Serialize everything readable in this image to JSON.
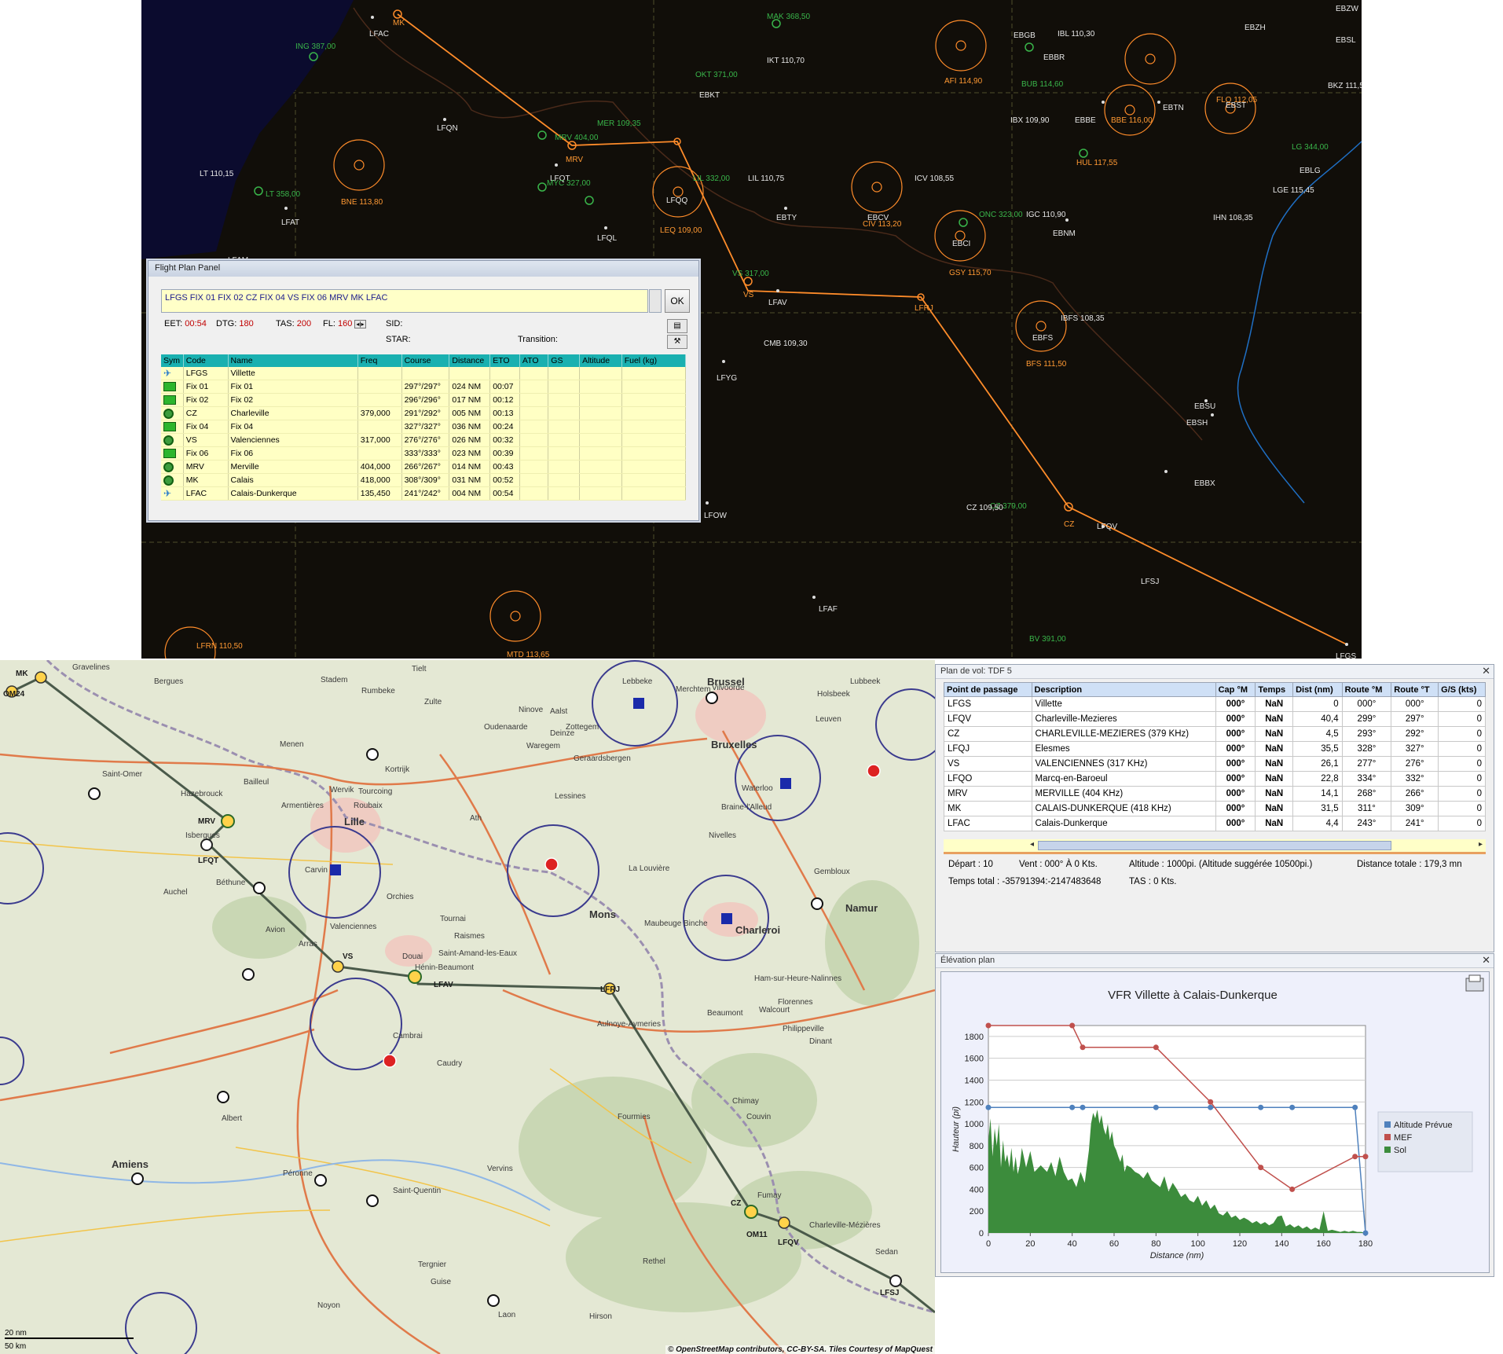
{
  "flight_plan_panel": {
    "title": "Flight Plan Panel",
    "route_string": "LFGS FIX 01 FIX 02 CZ FIX 04 VS FIX 06 MRV MK LFAC",
    "ok_label": "OK",
    "eet_label": "EET:",
    "eet_value": "00:54",
    "dtg_label": "DTG:",
    "dtg_value": "180",
    "tas_label": "TAS:",
    "tas_value": "200",
    "fl_label": "FL:",
    "fl_value": "160",
    "sid_label": "SID:",
    "star_label": "STAR:",
    "transition_label": "Transition:",
    "columns": [
      "Sym",
      "Code",
      "Name",
      "Freq",
      "Course",
      "Distance",
      "ETO",
      "ATO",
      "GS",
      "Altitude",
      "Fuel (kg)"
    ],
    "rows": [
      {
        "sym": "airport",
        "code": "LFGS",
        "name": "Villette",
        "freq": "",
        "course": "",
        "distance": "",
        "eto": ""
      },
      {
        "sym": "fix",
        "code": "Fix 01",
        "name": "Fix 01",
        "freq": "",
        "course": "297°/297°",
        "distance": "024 NM",
        "eto": "00:07"
      },
      {
        "sym": "fix",
        "code": "Fix 02",
        "name": "Fix 02",
        "freq": "",
        "course": "296°/296°",
        "distance": "017 NM",
        "eto": "00:12"
      },
      {
        "sym": "vor",
        "code": "CZ",
        "name": "Charleville",
        "freq": "379,000",
        "course": "291°/292°",
        "distance": "005 NM",
        "eto": "00:13"
      },
      {
        "sym": "fix",
        "code": "Fix 04",
        "name": "Fix 04",
        "freq": "",
        "course": "327°/327°",
        "distance": "036 NM",
        "eto": "00:24"
      },
      {
        "sym": "vor",
        "code": "VS",
        "name": "Valenciennes",
        "freq": "317,000",
        "course": "276°/276°",
        "distance": "026 NM",
        "eto": "00:32"
      },
      {
        "sym": "fix",
        "code": "Fix 06",
        "name": "Fix 06",
        "freq": "",
        "course": "333°/333°",
        "distance": "023 NM",
        "eto": "00:39"
      },
      {
        "sym": "vor",
        "code": "MRV",
        "name": "Merville",
        "freq": "404,000",
        "course": "266°/267°",
        "distance": "014 NM",
        "eto": "00:43"
      },
      {
        "sym": "vor",
        "code": "MK",
        "name": "Calais",
        "freq": "418,000",
        "course": "308°/309°",
        "distance": "031 NM",
        "eto": "00:52"
      },
      {
        "sym": "airport",
        "code": "LFAC",
        "name": "Calais-Dunkerque",
        "freq": "135,450",
        "course": "241°/242°",
        "distance": "004 NM",
        "eto": "00:54"
      }
    ]
  },
  "top_map": {
    "labels": [
      {
        "t": "LFAC",
        "c": "#e6e6e6"
      },
      {
        "t": "MK",
        "c": "#ff9933"
      },
      {
        "t": "ING 387,00",
        "c": "#39b54a"
      },
      {
        "t": "MAK 368,50",
        "c": "#39b54a"
      },
      {
        "t": "LFQN",
        "c": "#e6e6e6"
      },
      {
        "t": "MRV",
        "c": "#ff9933"
      },
      {
        "t": "MRV 404,00",
        "c": "#39b54a"
      },
      {
        "t": "MER 109,35",
        "c": "#39b54a"
      },
      {
        "t": "LFQT",
        "c": "#e6e6e6"
      },
      {
        "t": "MYC 327,00",
        "c": "#39b54a"
      },
      {
        "t": "LFQQ",
        "c": "#e6e6e6"
      },
      {
        "t": "LEQ 109,00",
        "c": "#ff9933"
      },
      {
        "t": "LIL 332,00",
        "c": "#39b54a"
      },
      {
        "t": "LIL 110,75",
        "c": "#e6e6e6"
      },
      {
        "t": "LT 110,15",
        "c": "#e6e6e6"
      },
      {
        "t": "LT 358,00",
        "c": "#39b54a"
      },
      {
        "t": "LFAT",
        "c": "#e6e6e6"
      },
      {
        "t": "BNE 113,80",
        "c": "#ff9933"
      },
      {
        "t": "LFQL",
        "c": "#e6e6e6"
      },
      {
        "t": "EBTY",
        "c": "#e6e6e6"
      },
      {
        "t": "EBCV",
        "c": "#e6e6e6"
      },
      {
        "t": "CIV 113,20",
        "c": "#ff9933"
      },
      {
        "t": "ICV 108,55",
        "c": "#e6e6e6"
      },
      {
        "t": "VS",
        "c": "#ff9933"
      },
      {
        "t": "VS 317,00",
        "c": "#39b54a"
      },
      {
        "t": "LFAV",
        "c": "#e6e6e6"
      },
      {
        "t": "LFRJ",
        "c": "#ff9933"
      },
      {
        "t": "CMB 109,30",
        "c": "#e6e6e6"
      },
      {
        "t": "LFYG",
        "c": "#e6e6e6"
      },
      {
        "t": "EBFS",
        "c": "#e6e6e6"
      },
      {
        "t": "BFS 111,50",
        "c": "#ff9933"
      },
      {
        "t": "IBFS 108,35",
        "c": "#e6e6e6"
      },
      {
        "t": "EBCI",
        "c": "#e6e6e6"
      },
      {
        "t": "GSY 115,70",
        "c": "#ff9933"
      },
      {
        "t": "ONC 323,00",
        "c": "#39b54a"
      },
      {
        "t": "IGC 110,90",
        "c": "#e6e6e6"
      },
      {
        "t": "EBNM",
        "c": "#e6e6e6"
      },
      {
        "t": "AFI 114,90",
        "c": "#ff9933"
      },
      {
        "t": "EBGB",
        "c": "#e6e6e6"
      },
      {
        "t": "EBBR",
        "c": "#e6e6e6"
      },
      {
        "t": "IBL 110,30",
        "c": "#e6e6e6"
      },
      {
        "t": "BUB 114,60",
        "c": "#39b54a"
      },
      {
        "t": "IBX 109,90",
        "c": "#e6e6e6"
      },
      {
        "t": "EBBE",
        "c": "#e6e6e6"
      },
      {
        "t": "BBE 116,00",
        "c": "#ff9933"
      },
      {
        "t": "HUL 117,55",
        "c": "#ff9933"
      },
      {
        "t": "EBTN",
        "c": "#e6e6e6"
      },
      {
        "t": "EBST",
        "c": "#e6e6e6"
      },
      {
        "t": "FLO 112,05",
        "c": "#ff9933"
      },
      {
        "t": "EBZH",
        "c": "#e6e6e6"
      },
      {
        "t": "EBZW",
        "c": "#e6e6e6"
      },
      {
        "t": "EBSL",
        "c": "#e6e6e6"
      },
      {
        "t": "BKZ 111,55",
        "c": "#e6e6e6"
      },
      {
        "t": "LG 344,00",
        "c": "#39b54a"
      },
      {
        "t": "EBLG",
        "c": "#e6e6e6"
      },
      {
        "t": "LGE 115,45",
        "c": "#e6e6e6"
      },
      {
        "t": "IHN 108,35",
        "c": "#e6e6e6"
      },
      {
        "t": "OKT 371,00",
        "c": "#39b54a"
      },
      {
        "t": "IKT 110,70",
        "c": "#e6e6e6"
      },
      {
        "t": "EBKT",
        "c": "#e6e6e6"
      },
      {
        "t": "EBSU",
        "c": "#e6e6e6"
      },
      {
        "t": "EBSH",
        "c": "#e6e6e6"
      },
      {
        "t": "EBBX",
        "c": "#e6e6e6"
      },
      {
        "t": "CZ",
        "c": "#ff9933"
      },
      {
        "t": "CZ 379,00",
        "c": "#39b54a"
      },
      {
        "t": "CZ 109,50",
        "c": "#e6e6e6"
      },
      {
        "t": "LFQV",
        "c": "#e6e6e6"
      },
      {
        "t": "LFSJ",
        "c": "#e6e6e6"
      },
      {
        "t": "LFGS",
        "c": "#e6e6e6"
      },
      {
        "t": "LFAF",
        "c": "#e6e6e6"
      },
      {
        "t": "LFOW",
        "c": "#e6e6e6"
      },
      {
        "t": "MTD 113,65",
        "c": "#ff9933"
      },
      {
        "t": "BV 391,00",
        "c": "#39b54a"
      },
      {
        "t": "LFAM",
        "c": "#e6e6e6"
      },
      {
        "t": "LFRN 110,50",
        "c": "#ff9933"
      }
    ]
  },
  "bottom_map": {
    "towns": [
      "Gravelines",
      "Bergues",
      "Saint-Omer",
      "Hazebrouck",
      "Bailleul",
      "Armentières",
      "Wervik",
      "Kortrijk",
      "Tourcoing",
      "Roubaix",
      "Lille",
      "Isbergues",
      "Béthune",
      "Auchel",
      "Carvin",
      "Orchies",
      "Tournai",
      "Saint-Amand-les-Eaux",
      "Valenciennes",
      "Hénin-Beaumont",
      "Arras",
      "Douai",
      "Cambrai",
      "Caudry",
      "Avion",
      "Raismes",
      "Mons",
      "La Louvière",
      "Charleroi",
      "Namur",
      "Gembloux",
      "Nivelles",
      "Waterloo",
      "Braine-l'Alleud",
      "Leuven",
      "Brussel",
      "Bruxelles",
      "Aalst",
      "Oudenaarde",
      "Ninove",
      "Geraardsbergen",
      "Lessines",
      "Ath",
      "Binche",
      "Beaumont",
      "Philippeville",
      "Dinant",
      "Walcourt",
      "Florennes",
      "Chimay",
      "Couvin",
      "Fumay",
      "Fourmies",
      "Maubeuge",
      "Aulnoye-Aymeries",
      "Saint-Quentin",
      "Péronne",
      "Albert",
      "Amiens",
      "Noyon",
      "Laon",
      "Tergnier",
      "Rethel",
      "Sedan",
      "Charleville-Mézières",
      "Hirson",
      "Guise",
      "Vervins",
      "Ham-sur-Heure-Nalinnes",
      "Lebbeke",
      "Merchtem",
      "Vilvoorde",
      "Holsbeek",
      "Lubbeek",
      "Zottegem",
      "Zulte",
      "Stadem",
      "Rumbeke",
      "Tielt",
      "Deinze",
      "Waregem",
      "Menen"
    ],
    "route_points": [
      "OM24",
      "MK",
      "MRV",
      "LFQT",
      "VS",
      "LFAV",
      "LFRJ",
      "CZ",
      "OM11",
      "LFQV",
      "LFSJ"
    ],
    "attribution": "© OpenStreetMap contributors, CC-BY-SA. Tiles Courtesy of MapQuest",
    "scale_top": "20 nm",
    "scale_bottom": "50 km"
  },
  "route_panel": {
    "title": "Plan de vol: TDF 5",
    "columns": [
      "Point de passage",
      "Description",
      "Cap °M",
      "Temps",
      "Dist (nm)",
      "Route °M",
      "Route °T",
      "G/S (kts)"
    ],
    "rows": [
      {
        "wp": "LFGS",
        "desc": "Villette",
        "cap": "000°",
        "temps": "NaN",
        "dist": "0",
        "rm": "000°",
        "rt": "000°",
        "gs": "0"
      },
      {
        "wp": "LFQV",
        "desc": "Charleville-Mezieres",
        "cap": "000°",
        "temps": "NaN",
        "dist": "40,4",
        "rm": "299°",
        "rt": "297°",
        "gs": "0"
      },
      {
        "wp": "CZ",
        "desc": "CHARLEVILLE-MEZIERES (379 KHz)",
        "cap": "000°",
        "temps": "NaN",
        "dist": "4,5",
        "rm": "293°",
        "rt": "292°",
        "gs": "0"
      },
      {
        "wp": "LFQJ",
        "desc": "Elesmes",
        "cap": "000°",
        "temps": "NaN",
        "dist": "35,5",
        "rm": "328°",
        "rt": "327°",
        "gs": "0"
      },
      {
        "wp": "VS",
        "desc": "VALENCIENNES (317 KHz)",
        "cap": "000°",
        "temps": "NaN",
        "dist": "26,1",
        "rm": "277°",
        "rt": "276°",
        "gs": "0"
      },
      {
        "wp": "LFQO",
        "desc": "Marcq-en-Baroeul",
        "cap": "000°",
        "temps": "NaN",
        "dist": "22,8",
        "rm": "334°",
        "rt": "332°",
        "gs": "0"
      },
      {
        "wp": "MRV",
        "desc": "MERVILLE (404 KHz)",
        "cap": "000°",
        "temps": "NaN",
        "dist": "14,1",
        "rm": "268°",
        "rt": "266°",
        "gs": "0"
      },
      {
        "wp": "MK",
        "desc": "CALAIS-DUNKERQUE (418 KHz)",
        "cap": "000°",
        "temps": "NaN",
        "dist": "31,5",
        "rm": "311°",
        "rt": "309°",
        "gs": "0"
      },
      {
        "wp": "LFAC",
        "desc": "Calais-Dunkerque",
        "cap": "000°",
        "temps": "NaN",
        "dist": "4,4",
        "rm": "243°",
        "rt": "241°",
        "gs": "0"
      }
    ],
    "depart": "Départ : 10",
    "vent": "Vent : 000° À 0 Kts.",
    "altitude": "Altitude : 1000pi. (Altitude suggérée 10500pi.)",
    "distance_totale": "Distance totale : 179,3 mn",
    "temps_total": "Temps total : -35791394:-2147483648",
    "tas": "TAS : 0 Kts."
  },
  "elevation_panel": {
    "title": "Élévation plan",
    "print_icon": "printer-icon"
  },
  "chart_data": {
    "type": "area",
    "title": "VFR Villette à Calais-Dunkerque",
    "xlabel": "Distance (nm)",
    "ylabel": "Hauteur (pi)",
    "xlim": [
      0,
      180
    ],
    "ylim": [
      0,
      1900
    ],
    "xticks": [
      "0",
      "20",
      "40",
      "60",
      "80",
      "100",
      "120",
      "140",
      "160",
      "180"
    ],
    "yticks": [
      "0",
      "200",
      "400",
      "600",
      "800",
      "1000",
      "1200",
      "1400",
      "1600",
      "1800"
    ],
    "series": [
      {
        "name": "Altitude Prévue",
        "color": "#4f81bd",
        "type": "line",
        "x": [
          0,
          40,
          45,
          80,
          106,
          130,
          145,
          175,
          180
        ],
        "y": [
          1150,
          1150,
          1150,
          1150,
          1150,
          1150,
          1150,
          1150,
          0
        ]
      },
      {
        "name": "MEF",
        "color": "#c0504d",
        "type": "line",
        "x": [
          0,
          40,
          45,
          80,
          106,
          130,
          145,
          175,
          180
        ],
        "y": [
          1900,
          1900,
          1700,
          1700,
          1200,
          600,
          400,
          700,
          700
        ]
      },
      {
        "name": "Sol",
        "color": "#3c8c3c",
        "type": "area",
        "x": [
          0,
          1,
          2,
          3,
          4,
          5,
          6,
          7,
          8,
          9,
          10,
          11,
          12,
          13,
          14,
          15,
          16,
          18,
          20,
          22,
          25,
          28,
          30,
          32,
          34,
          36,
          38,
          40,
          42,
          44,
          46,
          48,
          49,
          50,
          51,
          52,
          53,
          54,
          55,
          56,
          57,
          58,
          59,
          60,
          61,
          62,
          63,
          64,
          65,
          66,
          68,
          70,
          72,
          74,
          76,
          78,
          80,
          82,
          84,
          86,
          88,
          90,
          92,
          94,
          96,
          98,
          100,
          102,
          104,
          106,
          108,
          110,
          112,
          114,
          116,
          118,
          120,
          122,
          124,
          126,
          128,
          130,
          132,
          134,
          136,
          138,
          140,
          142,
          144,
          146,
          148,
          150,
          152,
          154,
          156,
          158,
          160,
          162,
          164,
          166,
          168,
          170,
          172,
          174,
          176,
          178,
          180
        ],
        "y": [
          850,
          1050,
          700,
          960,
          800,
          1000,
          600,
          850,
          650,
          720,
          600,
          780,
          560,
          700,
          540,
          620,
          780,
          600,
          750,
          560,
          620,
          560,
          650,
          520,
          700,
          560,
          480,
          500,
          420,
          560,
          460,
          760,
          1000,
          1100,
          1050,
          1130,
          1000,
          1080,
          960,
          900,
          1000,
          850,
          930,
          800,
          760,
          700,
          650,
          720,
          560,
          620,
          600,
          560,
          540,
          500,
          560,
          480,
          450,
          420,
          520,
          380,
          460,
          400,
          330,
          360,
          300,
          280,
          340,
          250,
          300,
          220,
          260,
          180,
          160,
          200,
          140,
          160,
          120,
          140,
          120,
          90,
          110,
          80,
          100,
          70,
          90,
          150,
          160,
          60,
          80,
          50,
          70,
          40,
          60,
          30,
          50,
          30,
          200,
          20,
          30,
          20,
          10,
          20,
          10,
          20,
          10,
          10,
          0
        ]
      }
    ],
    "legend_position": "right"
  }
}
